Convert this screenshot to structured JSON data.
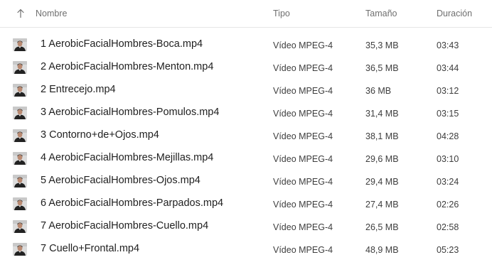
{
  "columns": {
    "name": "Nombre",
    "type": "Tipo",
    "size": "Tamaño",
    "duration": "Duración"
  },
  "sort": {
    "column": "name",
    "direction": "ascending",
    "icon": "arrow-up-icon"
  },
  "thumbnail_icon": "video-thumbnail-icon",
  "files": [
    {
      "name": "1 AerobicFacialHombres-Boca.mp4",
      "type": "Vídeo MPEG-4",
      "size": "35,3 MB",
      "duration": "03:43"
    },
    {
      "name": "2 AerobicFacialHombres-Menton.mp4",
      "type": "Vídeo MPEG-4",
      "size": "36,5 MB",
      "duration": "03:44"
    },
    {
      "name": "2 Entrecejo.mp4",
      "type": "Vídeo MPEG-4",
      "size": "36 MB",
      "duration": "03:12"
    },
    {
      "name": "3 AerobicFacialHombres-Pomulos.mp4",
      "type": "Vídeo MPEG-4",
      "size": "31,4 MB",
      "duration": "03:15"
    },
    {
      "name": "3 Contorno+de+Ojos.mp4",
      "type": "Vídeo MPEG-4",
      "size": "38,1 MB",
      "duration": "04:28"
    },
    {
      "name": "4 AerobicFacialHombres-Mejillas.mp4",
      "type": "Vídeo MPEG-4",
      "size": "29,6 MB",
      "duration": "03:10"
    },
    {
      "name": "5 AerobicFacialHombres-Ojos.mp4",
      "type": "Vídeo MPEG-4",
      "size": "29,4 MB",
      "duration": "03:24"
    },
    {
      "name": "6 AerobicFacialHombres-Parpados.mp4",
      "type": "Vídeo MPEG-4",
      "size": "27,4 MB",
      "duration": "02:26"
    },
    {
      "name": "7 AerobicFacialHombres-Cuello.mp4",
      "type": "Vídeo MPEG-4",
      "size": "26,5 MB",
      "duration": "02:58"
    },
    {
      "name": "7 Cuello+Frontal.mp4",
      "type": "Vídeo MPEG-4",
      "size": "48,9 MB",
      "duration": "05:23"
    }
  ]
}
